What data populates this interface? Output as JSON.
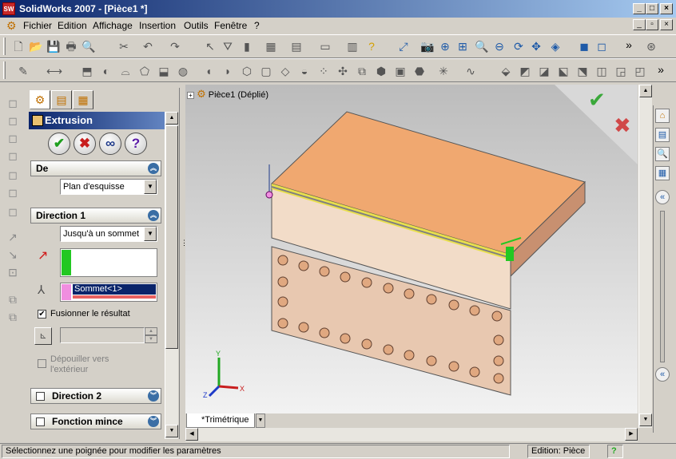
{
  "window": {
    "title": "SolidWorks 2007 - [Pièce1 *]",
    "app_icon": "SW"
  },
  "menu": {
    "items": [
      "Fichier",
      "Edition",
      "Affichage",
      "Insertion",
      "Outils",
      "Fenêtre",
      "?"
    ]
  },
  "feature_tree": {
    "root": "Pièce1",
    "state": "(Déplié)"
  },
  "property_manager": {
    "title": "Extrusion",
    "ok_icon": "✔",
    "cancel_icon": "✖",
    "preview_icon": "∞",
    "help_icon": "?",
    "from": {
      "header": "De",
      "value": "Plan d'esquisse"
    },
    "direction1": {
      "header": "Direction 1",
      "end_condition": "Jusqu'à un sommet",
      "vertex": "Sommet<1>"
    },
    "merge_result": {
      "label": "Fusionner le résultat",
      "checked": true
    },
    "draft_outward": {
      "label": "Dépouiller vers l'extérieur",
      "checked": false
    },
    "direction2": {
      "header": "Direction 2"
    },
    "thin_feature": {
      "header": "Fonction mince"
    }
  },
  "viewport": {
    "view_tab": "*Trimétrique",
    "axes": {
      "x": "X",
      "y": "Y",
      "z": "Z"
    }
  },
  "status": {
    "message": "Sélectionnez une poignée pour modifier les paramètres",
    "mode": "Edition: Pièce",
    "help": "?"
  },
  "colors": {
    "title_start": "#0a246a",
    "title_end": "#a6caf0",
    "top_face": "#f0a870",
    "front_face": "#f2dcc8",
    "plate_face": "#e8c8b0",
    "highlight": "#e8e040",
    "accent_green": "#28c828"
  }
}
